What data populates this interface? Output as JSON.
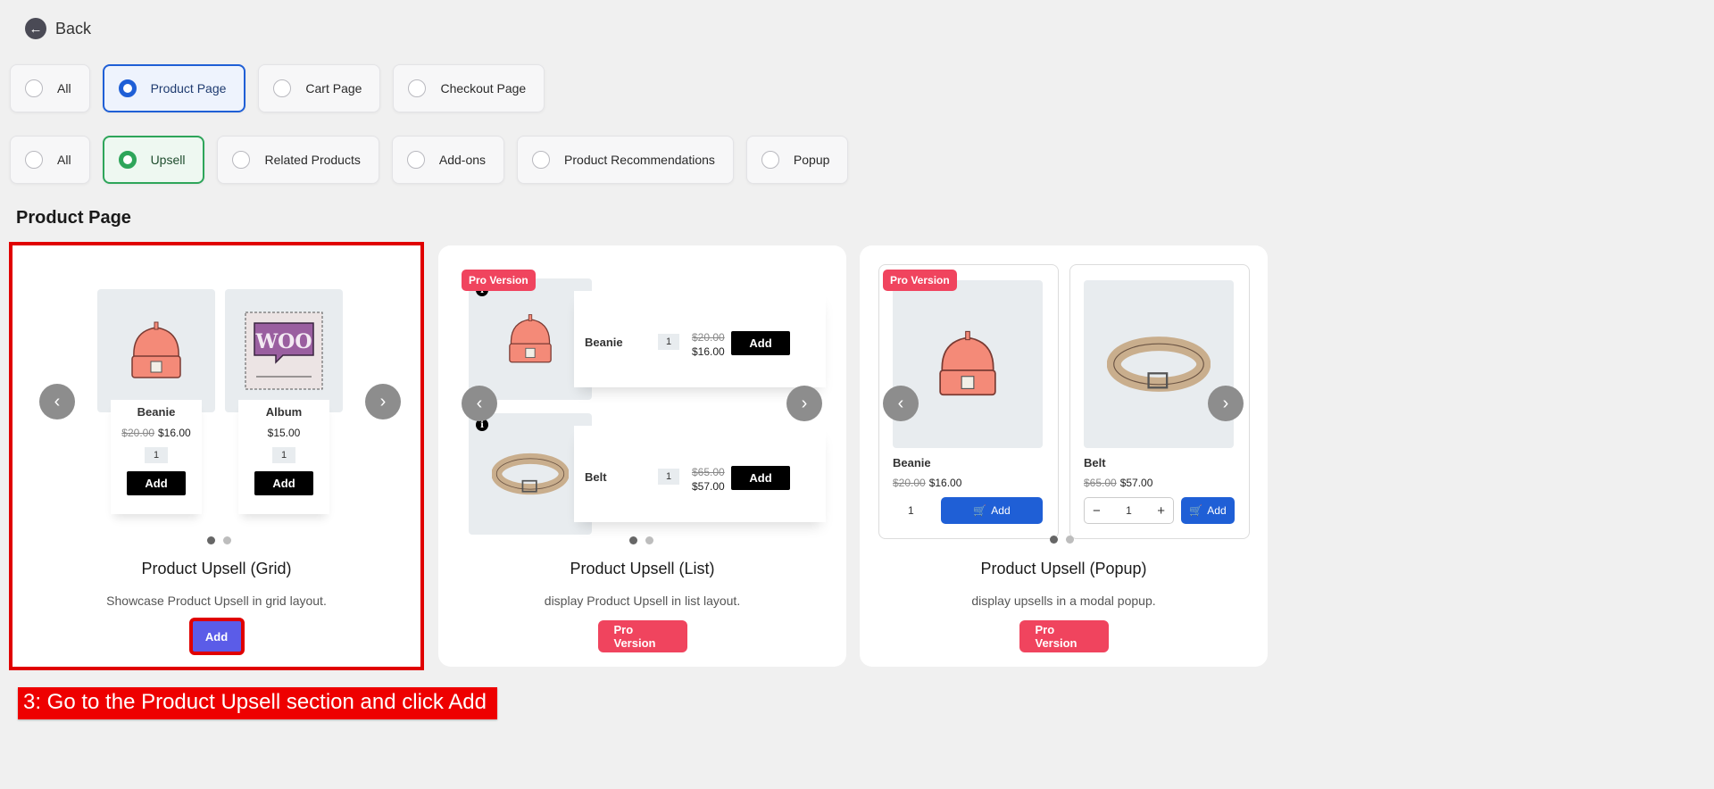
{
  "back_label": "Back",
  "location_filters": [
    {
      "label": "All",
      "selected": false
    },
    {
      "label": "Product Page",
      "selected": true
    },
    {
      "label": "Cart Page",
      "selected": false
    },
    {
      "label": "Checkout Page",
      "selected": false
    }
  ],
  "type_filters": [
    {
      "label": "All",
      "selected": false
    },
    {
      "label": "Upsell",
      "selected": true
    },
    {
      "label": "Related Products",
      "selected": false
    },
    {
      "label": "Add-ons",
      "selected": false
    },
    {
      "label": "Product Recommendations",
      "selected": false
    },
    {
      "label": "Popup",
      "selected": false
    }
  ],
  "section_title": "Product Page",
  "cards": [
    {
      "title": "Product Upsell (Grid)",
      "description": "Showcase Product Upsell in grid layout.",
      "button": "Add",
      "products": [
        {
          "name": "Beanie",
          "old_price": "$20.00",
          "price": "$16.00",
          "qty": "1",
          "add": "Add"
        },
        {
          "name": "Album",
          "old_price": "",
          "price": "$15.00",
          "qty": "1",
          "add": "Add"
        }
      ]
    },
    {
      "title": "Product Upsell (List)",
      "description": "display Product Upsell in list layout.",
      "badge": "Pro Version",
      "button": "Pro Version",
      "products": [
        {
          "name": "Beanie",
          "old_price": "$20.00",
          "price": "$16.00",
          "qty": "1",
          "add": "Add"
        },
        {
          "name": "Belt",
          "old_price": "$65.00",
          "price": "$57.00",
          "qty": "1",
          "add": "Add"
        }
      ]
    },
    {
      "title": "Product Upsell (Popup)",
      "description": "display upsells in a modal popup.",
      "badge": "Pro Version",
      "button": "Pro Version",
      "products": [
        {
          "name": "Beanie",
          "old_price": "$20.00",
          "price": "$16.00",
          "qty": "1",
          "add": "Add"
        },
        {
          "name": "Belt",
          "old_price": "$65.00",
          "price": "$57.00",
          "qty": "1",
          "add": "Add"
        }
      ]
    }
  ],
  "instruction": "3: Go to the Product Upsell section and click Add",
  "colors": {
    "accent_blue": "#1f5fd6",
    "accent_green": "#2ea55a",
    "pro_red": "#f0445e",
    "add_purple": "#5b5ce8",
    "highlight_red": "#e00000"
  }
}
